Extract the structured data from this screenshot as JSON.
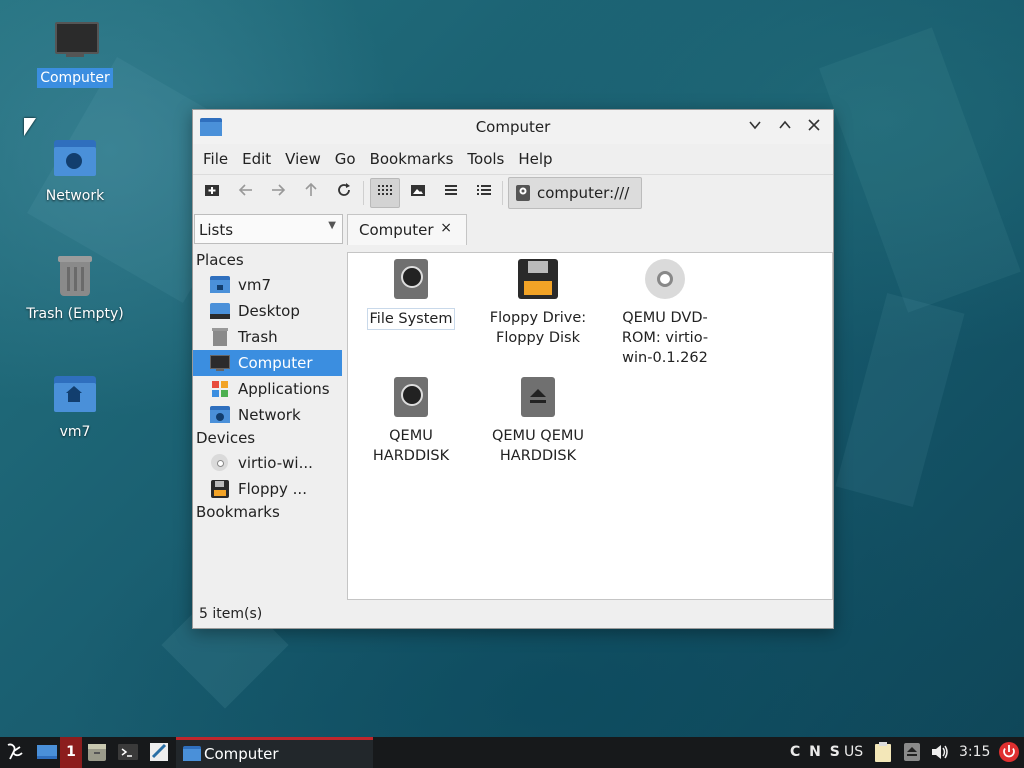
{
  "desktop": {
    "icons": [
      {
        "label": "Computer"
      },
      {
        "label": "Network"
      },
      {
        "label": "Trash (Empty)"
      },
      {
        "label": "vm7"
      }
    ]
  },
  "window": {
    "title": "Computer",
    "menu": [
      "File",
      "Edit",
      "View",
      "Go",
      "Bookmarks",
      "Tools",
      "Help"
    ],
    "toolbar": {
      "buttons": [
        "new-tab-icon",
        "back-arrow-icon",
        "forward-arrow-icon",
        "up-arrow-icon",
        "reload-icon",
        "icon-view-icon",
        "thumbnail-view-icon",
        "compact-view-icon",
        "detailed-list-icon"
      ],
      "location": "computer:///"
    },
    "sidebar": {
      "mode": "Lists",
      "places_header": "Places",
      "places": [
        {
          "label": "vm7",
          "icon": "home-folder-icon"
        },
        {
          "label": "Desktop",
          "icon": "desktop-icon"
        },
        {
          "label": "Trash",
          "icon": "trash-icon"
        },
        {
          "label": "Computer",
          "icon": "computer-icon",
          "selected": true
        },
        {
          "label": "Applications",
          "icon": "applications-icon"
        },
        {
          "label": "Network",
          "icon": "network-folder-icon"
        }
      ],
      "devices_header": "Devices",
      "devices": [
        {
          "label": "virtio-wi...",
          "icon": "optical-disc-icon"
        },
        {
          "label": "Floppy ...",
          "icon": "floppy-icon"
        }
      ],
      "bookmarks_header": "Bookmarks"
    },
    "tab": {
      "label": "Computer",
      "close": "×"
    },
    "items": [
      {
        "label": "File System",
        "icon": "hard-disk-icon",
        "selected": true
      },
      {
        "label": "Floppy Drive: Floppy Disk",
        "icon": "floppy-disk-icon"
      },
      {
        "label": "QEMU DVD-ROM: virtio-win-0.1.262",
        "icon": "optical-disc-icon"
      },
      {
        "label": "QEMU HARDDISK",
        "icon": "hard-disk-icon"
      },
      {
        "label": "QEMU QEMU HARDDISK",
        "icon": "removable-disk-icon"
      }
    ],
    "status": "5 item(s)"
  },
  "taskbar": {
    "workspace": "1",
    "task_label": "Computer",
    "tray": {
      "indicators": "C N S",
      "layout": "US",
      "clock": "3:15"
    }
  },
  "colors": {
    "accent": "#3b8ee0",
    "folder": "#4a90d9",
    "taskbar": "#17191b"
  }
}
